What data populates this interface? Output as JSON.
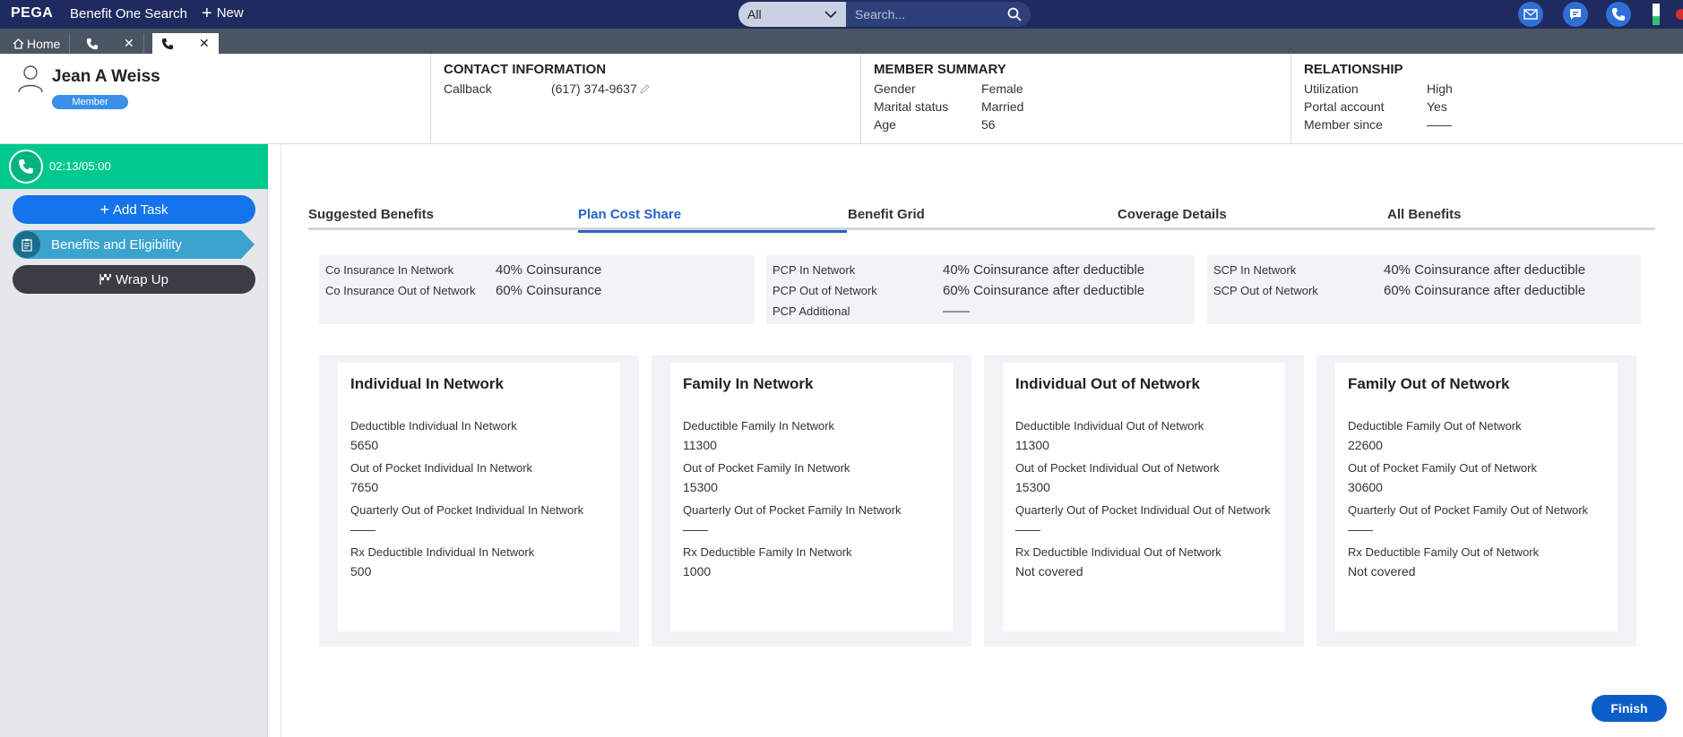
{
  "topbar": {
    "logo": "PEGA",
    "app_title": "Benefit One Search",
    "new_label": "New",
    "search_scope": "All",
    "search_placeholder": "Search..."
  },
  "tabstrip": {
    "home_label": "Home"
  },
  "member": {
    "name": "Jean A Weiss",
    "badge": "Member"
  },
  "contact": {
    "title": "CONTACT INFORMATION",
    "callback_label": "Callback",
    "callback_value": "(617) 374-9637"
  },
  "summary_block": {
    "title": "MEMBER SUMMARY",
    "rows": [
      {
        "k": "Gender",
        "v": "Female"
      },
      {
        "k": "Marital status",
        "v": "Married"
      },
      {
        "k": "Age",
        "v": "56"
      }
    ]
  },
  "relationship": {
    "title": "RELATIONSHIP",
    "rows": [
      {
        "k": "Utilization",
        "v": "High"
      },
      {
        "k": "Portal account",
        "v": "Yes"
      },
      {
        "k": "Member since",
        "v": "——"
      }
    ]
  },
  "left_panel": {
    "timer": "02:13/05:00",
    "add_task": "Add Task",
    "benefits": "Benefits and Eligibility",
    "wrap_up": "Wrap Up"
  },
  "tabs": [
    "Suggested Benefits",
    "Plan Cost Share",
    "Benefit Grid",
    "Coverage Details",
    "All Benefits"
  ],
  "cost_share": [
    [
      {
        "k": "Co Insurance In Network",
        "v": "40% Coinsurance"
      },
      {
        "k": "Co Insurance Out of Network",
        "v": "60% Coinsurance"
      }
    ],
    [
      {
        "k": "PCP In Network",
        "v": "40% Coinsurance after deductible"
      },
      {
        "k": "PCP Out of Network",
        "v": "60% Coinsurance after deductible"
      },
      {
        "k": "PCP Additional",
        "v": "——"
      }
    ],
    [
      {
        "k": "SCP In Network",
        "v": "40% Coinsurance after deductible"
      },
      {
        "k": "SCP Out of Network",
        "v": "60% Coinsurance after deductible"
      }
    ]
  ],
  "cards": [
    {
      "title": "Individual In Network",
      "fields": [
        {
          "label": "Deductible Individual In Network",
          "value": "5650"
        },
        {
          "label": "Out of Pocket Individual In Network",
          "value": "7650"
        },
        {
          "label": "Quarterly Out of Pocket Individual In Network",
          "value": "——"
        },
        {
          "label": "Rx Deductible Individual In Network",
          "value": "500"
        }
      ]
    },
    {
      "title": "Family In Network",
      "fields": [
        {
          "label": "Deductible Family In Network",
          "value": "11300"
        },
        {
          "label": "Out of Pocket Family In Network",
          "value": "15300"
        },
        {
          "label": "Quarterly Out of Pocket Family In Network",
          "value": "——"
        },
        {
          "label": "Rx Deductible Family In Network",
          "value": "1000"
        }
      ]
    },
    {
      "title": "Individual Out of Network",
      "fields": [
        {
          "label": "Deductible Individual Out of Network",
          "value": "11300"
        },
        {
          "label": "Out of Pocket Individual Out of Network",
          "value": "15300"
        },
        {
          "label": "Quarterly Out of Pocket Individual Out of Network",
          "value": "——"
        },
        {
          "label": "Rx Deductible Individual Out of Network",
          "value": "Not covered"
        }
      ]
    },
    {
      "title": "Family Out of Network",
      "fields": [
        {
          "label": "Deductible Family Out of Network",
          "value": "22600"
        },
        {
          "label": "Out of Pocket Family Out of Network",
          "value": "30600"
        },
        {
          "label": "Quarterly Out of Pocket Family Out of Network",
          "value": "——"
        },
        {
          "label": "Rx Deductible Family Out of Network",
          "value": "Not covered"
        }
      ]
    }
  ],
  "finish_label": "Finish",
  "colors": {
    "brand_navy": "#1f2a5e",
    "call_green": "#00c98d",
    "accent_blue": "#2563c4"
  }
}
